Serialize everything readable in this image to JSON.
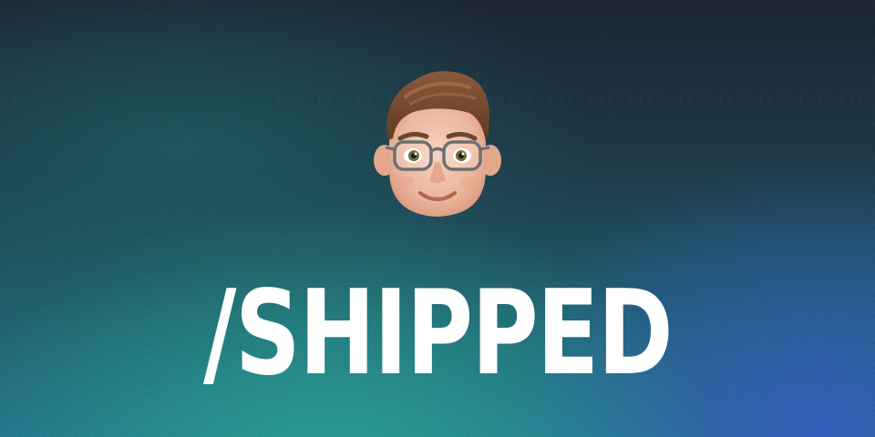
{
  "headline": "/SHIPPED",
  "avatar": {
    "icon": "memoji-avatar-icon"
  },
  "colors": {
    "background_top": "#1a2230",
    "background_teal": "#28aa96",
    "background_blue": "#325abe",
    "text": "#ffffff"
  }
}
